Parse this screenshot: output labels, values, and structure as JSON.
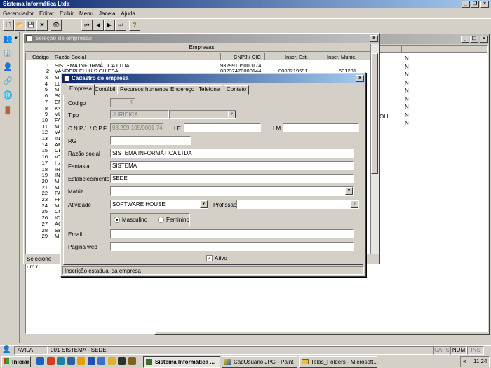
{
  "app": {
    "title": "Sistema Informática Ltda",
    "menu": [
      "Gerenciador",
      "Editar",
      "Exibir",
      "Menu",
      "Janela",
      "Ajuda"
    ]
  },
  "toolbar": {
    "icons": [
      "new-icon",
      "open-icon",
      "save-icon",
      "delete-icon",
      "binoculars-icon",
      "first-icon",
      "prev-icon",
      "next-icon",
      "last-icon",
      "help-icon"
    ]
  },
  "sidebar": {
    "icons": [
      "users-icon",
      "building-icon",
      "person-icon",
      "network-icon",
      "globe-icon",
      "exit-icon"
    ]
  },
  "selecao": {
    "title": "Seleção de empresas",
    "group_header": "Empresas",
    "columns": [
      "Código",
      "Razão Social",
      "CNPJ / CIC",
      "Inscr. Est.",
      "Inscr. Munic."
    ],
    "first_row": {
      "codigo": "1",
      "razao": "SISTEMA INFORMÁTICA LTDA",
      "cnpj": "93299105000174"
    },
    "second_row": {
      "codigo": "2",
      "razao": "VANDERLEI LUIS CHIESA",
      "cnpj": "03237470000144",
      "ie": "0003219591",
      "im": "591281"
    },
    "rows": [
      {
        "codigo": "3",
        "prefix": "M"
      },
      {
        "codigo": "4",
        "prefix": "LL"
      },
      {
        "codigo": "5",
        "prefix": "M"
      },
      {
        "codigo": "6",
        "prefix": "SO"
      },
      {
        "codigo": "7",
        "prefix": "EN"
      },
      {
        "codigo": "8",
        "prefix": "KV"
      },
      {
        "codigo": "9",
        "prefix": "VL"
      },
      {
        "codigo": "10",
        "prefix": "FA"
      },
      {
        "codigo": "11",
        "prefix": "MI"
      },
      {
        "codigo": "12",
        "prefix": "VA"
      },
      {
        "codigo": "13",
        "prefix": "IN"
      },
      {
        "codigo": "14",
        "prefix": "AF"
      },
      {
        "codigo": "15",
        "prefix": "CE"
      },
      {
        "codigo": "16",
        "prefix": "VT"
      },
      {
        "codigo": "17",
        "prefix": "HA"
      },
      {
        "codigo": "18",
        "prefix": "IR"
      },
      {
        "codigo": "19",
        "prefix": "IN"
      },
      {
        "codigo": "20",
        "prefix": "M"
      },
      {
        "codigo": "21",
        "prefix": "MI"
      },
      {
        "codigo": "22",
        "prefix": "PA"
      },
      {
        "codigo": "23",
        "prefix": "FF"
      },
      {
        "codigo": "24",
        "prefix": "MI"
      },
      {
        "codigo": "25",
        "prefix": "CC"
      },
      {
        "codigo": "26",
        "prefix": "IC"
      },
      {
        "codigo": "27",
        "prefix": "AC"
      },
      {
        "codigo": "28",
        "prefix": "SE"
      },
      {
        "codigo": "29",
        "prefix": "M"
      }
    ],
    "status": "Selecione um r"
  },
  "background_window": {
    "col_values": [
      "N",
      "N",
      "N",
      "N",
      "N",
      "N",
      "N",
      "N",
      "N"
    ],
    "partial_text": "OLL"
  },
  "cadastro": {
    "title": "Cadastro de empresa",
    "tabs": [
      "Empresa",
      "Contábil",
      "Recursos humanos",
      "Endereço",
      "Telefone",
      "Contato"
    ],
    "fields": {
      "codigo_label": "Código",
      "codigo_value": "1",
      "tipo_label": "Tipo",
      "tipo_value": "JURIDICA",
      "cnpj_label": "C.N.P.J. / C.P.F.",
      "cnpj_value": "93.299.105/0001-74",
      "ie_label": "I.E.",
      "im_label": "I.M.",
      "rg_label": "RG",
      "razao_label": "Razão social",
      "razao_value": "SISTEMA INFORMÁTICA LTDA",
      "fantasia_label": "Fantasia",
      "fantasia_value": "SISTEMA",
      "estab_label": "Estabelecimento",
      "estab_value": "SEDE",
      "matriz_label": "Matriz",
      "atividade_label": "Atividade",
      "atividade_value": "SOFTWARE HOUSE",
      "profissao_label": "Profissão",
      "masculino_label": "Masculino",
      "feminino_label": "Feminino",
      "email_label": "Email",
      "web_label": "Página web",
      "ativo_label": "Ativo"
    },
    "status": "Inscrição estadual da empresa"
  },
  "statusbar": {
    "user": "AVILA",
    "company": "001-SISTEMA - SEDE",
    "caps": "CAPS",
    "num": "NUM",
    "ins": "INS"
  },
  "taskbar": {
    "start": "Iniciar",
    "quicklaunch": [
      "ie-icon",
      "outlook-icon",
      "desktop-icon",
      "media-icon",
      "explorer-icon",
      "word-icon",
      "mail-icon",
      "folder-icon",
      "cmd-icon",
      "pen-icon"
    ],
    "buttons": [
      "Sistema Informática ...",
      "CadUsuario.JPG - Paint",
      "Telas_Folders - Microsoft..."
    ],
    "clock": "11:24",
    "tray_label": "«"
  }
}
